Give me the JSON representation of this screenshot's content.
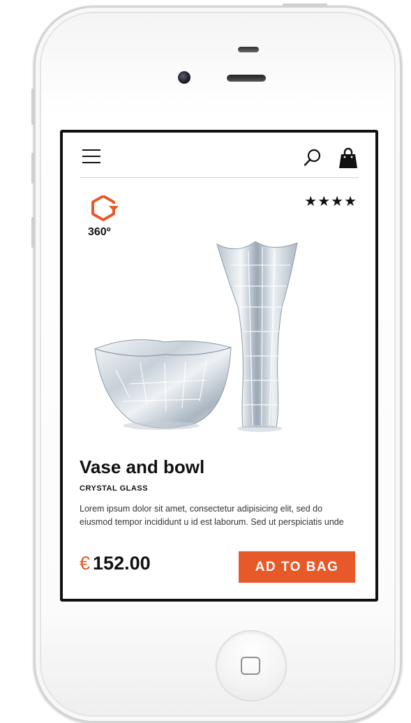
{
  "header": {
    "menu_icon": "hamburger-menu-icon",
    "search_icon": "search-icon",
    "bag_icon": "shopping-bag-icon"
  },
  "product": {
    "view_360_label": "360º",
    "view_360_icon": "rotate-360-icon",
    "rating_text": "★★★★",
    "rating": 4,
    "title": "Vase and bowl",
    "subtitle": "CRYSTAL GLASS",
    "description": "Lorem ipsum dolor sit amet, consectetur adipisicing elit, sed do eiusmod tempor incididunt u id est laborum. Sed ut perspiciatis unde",
    "currency": "€",
    "price": "152.00",
    "add_button_label": "AD TO BAG"
  },
  "colors": {
    "accent": "#e8592a",
    "text": "#111111"
  }
}
